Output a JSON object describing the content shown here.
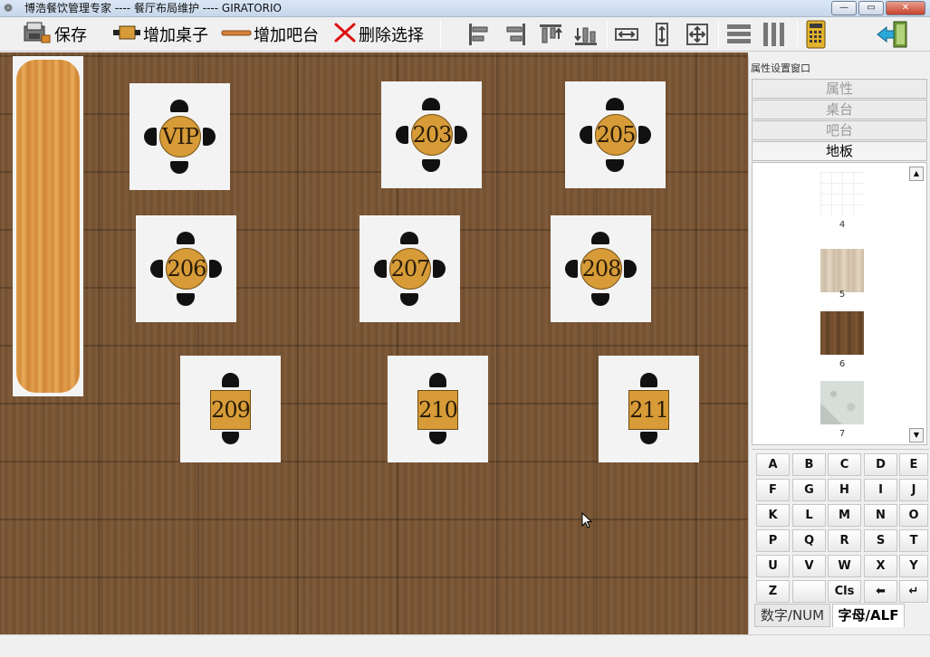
{
  "window": {
    "title": "博浩餐饮管理专家 ---- 餐厅布局维护 ---- GIRATORIO",
    "min_label": "—",
    "max_label": "▭",
    "close_label": "✕"
  },
  "toolbar": {
    "save_label": "保存",
    "add_table_label": "增加桌子",
    "add_bar_label": "增加吧台",
    "delete_label": "删除选择"
  },
  "tables": [
    {
      "label": "VIP"
    },
    {
      "label": "203"
    },
    {
      "label": "205"
    },
    {
      "label": "206"
    },
    {
      "label": "207"
    },
    {
      "label": "208"
    },
    {
      "label": "209"
    },
    {
      "label": "210"
    },
    {
      "label": "211"
    }
  ],
  "panel": {
    "title": "属性设置窗口",
    "tabs": [
      "属性",
      "桌台",
      "吧台",
      "地板"
    ],
    "active_tab": "地板",
    "floors": [
      "4",
      "5",
      "6",
      "7"
    ]
  },
  "keypad": {
    "keys": [
      "A",
      "B",
      "C",
      "D",
      "E",
      "F",
      "G",
      "H",
      "I",
      "J",
      "K",
      "L",
      "M",
      "N",
      "O",
      "P",
      "Q",
      "R",
      "S",
      "T",
      "U",
      "V",
      "W",
      "X",
      "Y",
      "Z",
      "",
      "Cls",
      "⬅",
      "↵"
    ],
    "tab_num": "数字/NUM",
    "tab_alf": "字母/ALF"
  },
  "colors": {
    "table_fill": "#d79c38",
    "floor_wood": "#7a5533",
    "bar_wood": "#e3a14e"
  }
}
